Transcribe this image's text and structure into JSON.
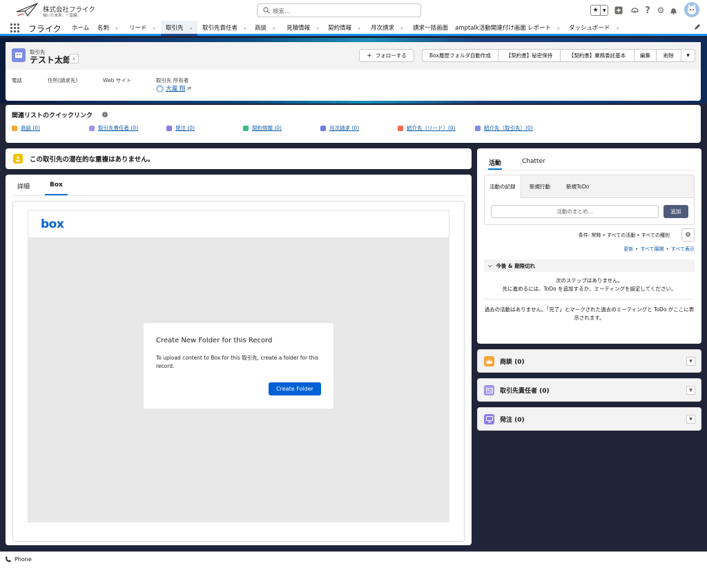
{
  "header": {
    "brand_name": "株式会社フライク",
    "brand_tagline": "描いた未来、一直線。",
    "search_placeholder": "検索..."
  },
  "nav": {
    "app_name": "フライク",
    "items": [
      "ホーム",
      "名刺",
      "リード",
      "取引先",
      "取引先責任者",
      "商談",
      "見積情報",
      "契約情報",
      "月次請求",
      "請求一括画面",
      "amptalk活動関連付け画面",
      "レポート",
      "ダッシュボード"
    ],
    "active": "取引先"
  },
  "record": {
    "object_label": "取引先",
    "name": "テスト太郎",
    "follow_label": "フォローする",
    "actions": [
      "Box履歴フォルダ自動作成",
      "【契約書】秘密保持",
      "【契約書】業務委託基本",
      "編集",
      "削除"
    ],
    "fields": {
      "phone_label": "電話",
      "address_label": "住所(請求先)",
      "website_label": "Web サイト",
      "owner_label": "取引先 所有者",
      "owner_value": "大瀧 翔"
    }
  },
  "quick_links": {
    "title": "関連リストのクイックリンク",
    "items": [
      {
        "label": "商談 (0)",
        "color": "#f4a73b"
      },
      {
        "label": "取引先責任者 (0)",
        "color": "#a094ed"
      },
      {
        "label": "発注 (0)",
        "color": "#8c7de8"
      },
      {
        "label": "契約情報 (0)",
        "color": "#3bba8a"
      },
      {
        "label": "月次請求 (0)",
        "color": "#6f7ee0"
      },
      {
        "label": "紹介先（リード）(0)",
        "color": "#f26c4f"
      },
      {
        "label": "紹介先（取引先）(0)",
        "color": "#7f8de1"
      }
    ]
  },
  "duplicate_alert": "この取引先の潜在的な重複はありません。",
  "main_tabs": {
    "details": "詳細",
    "box": "Box"
  },
  "box": {
    "logo": "box",
    "modal_title": "Create New Folder for this Record",
    "modal_desc": "To upload content to Box for this 取引先, create a folder for this record.",
    "create_button": "Create Folder"
  },
  "activity": {
    "tabs": [
      "活動",
      "Chatter"
    ],
    "publisher_tabs": [
      "活動の記録",
      "新規行動",
      "新規ToDo"
    ],
    "summary_placeholder": "活動のまとめ...",
    "add_label": "追加",
    "filter_text": "条件: 常時 • すべての活動 • すべての種別",
    "links": [
      "更新",
      "すべて展開",
      "すべて表示"
    ],
    "upcoming_label": "今後 & 期限切れ",
    "no_steps_1": "次のステップはありません。",
    "no_steps_2": "先に進めるには、ToDo を追加するか、ミーティングを設定してください。",
    "no_past": "過去の活動はありません。「完了」とマークされた過去のミーティングと ToDo がここに表示されます。"
  },
  "related_lists": [
    {
      "title": "商談 (0)",
      "color": "#f4a73b"
    },
    {
      "title": "取引先責任者 (0)",
      "color": "#a094ed"
    },
    {
      "title": "発注 (0)",
      "color": "#8c7de8"
    }
  ],
  "utility": {
    "phone_label": "Phone"
  }
}
